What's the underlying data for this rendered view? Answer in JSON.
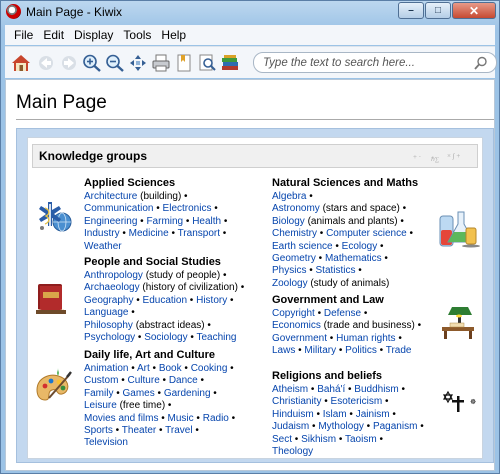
{
  "window": {
    "title": "Main Page - Kiwix",
    "min_label": "–",
    "max_label": "□",
    "close_label": "✕"
  },
  "menu": {
    "file": "File",
    "edit": "Edit",
    "display": "Display",
    "tools": "Tools",
    "help": "Help"
  },
  "toolbar": {
    "icons": [
      "home-icon",
      "back-icon",
      "forward-icon",
      "zoom-in-icon",
      "zoom-out-icon",
      "fullscreen-icon",
      "print-icon",
      "bookmark-icon",
      "find-icon",
      "library-icon"
    ],
    "search_placeholder": "Type the text to search here..."
  },
  "page": {
    "title": "Main Page"
  },
  "kg": {
    "title": "Knowledge groups",
    "sections": {
      "applied": {
        "title": "Applied Sciences",
        "lines": [
          [
            [
              "Architecture",
              1
            ],
            [
              " (building) •",
              0
            ]
          ],
          [
            [
              "Communication",
              1
            ],
            [
              " • ",
              0
            ],
            [
              "Electronics",
              1
            ],
            [
              " •",
              0
            ]
          ],
          [
            [
              "Engineering",
              1
            ],
            [
              " • ",
              0
            ],
            [
              "Farming",
              1
            ],
            [
              " • ",
              0
            ],
            [
              "Health",
              1
            ],
            [
              " •",
              0
            ]
          ],
          [
            [
              "Industry",
              1
            ],
            [
              " • ",
              0
            ],
            [
              "Medicine",
              1
            ],
            [
              " • ",
              0
            ],
            [
              "Transport",
              1
            ],
            [
              " •",
              0
            ]
          ],
          [
            [
              "Weather",
              1
            ]
          ]
        ]
      },
      "people": {
        "title": "People and Social Studies",
        "lines": [
          [
            [
              "Anthropology",
              1
            ],
            [
              " (study of people) •",
              0
            ]
          ],
          [
            [
              "Archaeology",
              1
            ],
            [
              " (history of civilization) •",
              0
            ]
          ],
          [
            [
              "Geography",
              1
            ],
            [
              " • ",
              0
            ],
            [
              "Education",
              1
            ],
            [
              " • ",
              0
            ],
            [
              "History",
              1
            ],
            [
              " •",
              0
            ]
          ],
          [
            [
              "Language",
              1
            ],
            [
              " •",
              0
            ]
          ],
          [
            [
              "Philosophy",
              1
            ],
            [
              " (abstract ideas) •",
              0
            ]
          ],
          [
            [
              "Psychology",
              1
            ],
            [
              " • ",
              0
            ],
            [
              "Sociology",
              1
            ],
            [
              " • ",
              0
            ],
            [
              "Teaching",
              1
            ]
          ]
        ]
      },
      "daily": {
        "title": "Daily life, Art and Culture",
        "lines": [
          [
            [
              "Animation",
              1
            ],
            [
              " • ",
              0
            ],
            [
              "Art",
              1
            ],
            [
              " • ",
              0
            ],
            [
              "Book",
              1
            ],
            [
              " • ",
              0
            ],
            [
              "Cooking",
              1
            ],
            [
              " •",
              0
            ]
          ],
          [
            [
              "Custom",
              1
            ],
            [
              " • ",
              0
            ],
            [
              "Culture",
              1
            ],
            [
              " • ",
              0
            ],
            [
              "Dance",
              1
            ],
            [
              " •",
              0
            ]
          ],
          [
            [
              "Family",
              1
            ],
            [
              " • ",
              0
            ],
            [
              "Games",
              1
            ],
            [
              " • ",
              0
            ],
            [
              "Gardening",
              1
            ],
            [
              " •",
              0
            ]
          ],
          [
            [
              "Leisure",
              1
            ],
            [
              " (free time) •",
              0
            ]
          ],
          [
            [
              "Movies and films",
              1
            ],
            [
              " • ",
              0
            ],
            [
              "Music",
              1
            ],
            [
              " • ",
              0
            ],
            [
              "Radio",
              1
            ],
            [
              " •",
              0
            ]
          ],
          [
            [
              "Sports",
              1
            ],
            [
              " • ",
              0
            ],
            [
              "Theater",
              1
            ],
            [
              " • ",
              0
            ],
            [
              "Travel",
              1
            ],
            [
              " •",
              0
            ]
          ],
          [
            [
              "Television",
              1
            ]
          ]
        ]
      },
      "natural": {
        "title": "Natural Sciences and Maths",
        "lines": [
          [
            [
              "Algebra",
              1
            ],
            [
              " •",
              0
            ]
          ],
          [
            [
              "Astronomy",
              1
            ],
            [
              " (stars and space) •",
              0
            ]
          ],
          [
            [
              "Biology",
              1
            ],
            [
              " (animals and plants) •",
              0
            ]
          ],
          [
            [
              "Chemistry",
              1
            ],
            [
              " • ",
              0
            ],
            [
              "Computer science",
              1
            ],
            [
              " •",
              0
            ]
          ],
          [
            [
              "Earth science",
              1
            ],
            [
              " • ",
              0
            ],
            [
              "Ecology",
              1
            ],
            [
              " •",
              0
            ]
          ],
          [
            [
              "Geometry",
              1
            ],
            [
              " • ",
              0
            ],
            [
              "Mathematics",
              1
            ],
            [
              " •",
              0
            ]
          ],
          [
            [
              "Physics",
              1
            ],
            [
              " • ",
              0
            ],
            [
              "Statistics",
              1
            ],
            [
              " •",
              0
            ]
          ],
          [
            [
              "Zoology",
              1
            ],
            [
              " (study of animals)",
              0
            ]
          ]
        ]
      },
      "gov": {
        "title": "Government and Law",
        "lines": [
          [
            [
              "Copyright",
              1
            ],
            [
              " • ",
              0
            ],
            [
              "Defense",
              1
            ],
            [
              " •",
              0
            ]
          ],
          [
            [
              "Economics",
              1
            ],
            [
              " (trade and business) •",
              0
            ]
          ],
          [
            [
              "Government",
              1
            ],
            [
              " • ",
              0
            ],
            [
              "Human rights",
              1
            ],
            [
              " •",
              0
            ]
          ],
          [
            [
              "Laws",
              1
            ],
            [
              " • ",
              0
            ],
            [
              "Military",
              1
            ],
            [
              " • ",
              0
            ],
            [
              "Politics",
              1
            ],
            [
              " • ",
              0
            ],
            [
              "Trade",
              1
            ]
          ]
        ]
      },
      "religion": {
        "title": "Religions and beliefs",
        "lines": [
          [
            [
              "Atheism",
              1
            ],
            [
              " • ",
              0
            ],
            [
              "Bahá'í",
              1
            ],
            [
              " • ",
              0
            ],
            [
              "Buddhism",
              1
            ],
            [
              " •",
              0
            ]
          ],
          [
            [
              "Christianity",
              1
            ],
            [
              " • ",
              0
            ],
            [
              "Esotericism",
              1
            ],
            [
              " •",
              0
            ]
          ],
          [
            [
              "Hinduism",
              1
            ],
            [
              " • ",
              0
            ],
            [
              "Islam",
              1
            ],
            [
              " • ",
              0
            ],
            [
              "Jainism",
              1
            ],
            [
              " •",
              0
            ]
          ],
          [
            [
              "Judaism",
              1
            ],
            [
              " • ",
              0
            ],
            [
              "Mythology",
              1
            ],
            [
              " • ",
              0
            ],
            [
              "Paganism",
              1
            ],
            [
              " •",
              0
            ]
          ],
          [
            [
              "Sect",
              1
            ],
            [
              " • ",
              0
            ],
            [
              "Sikhism",
              1
            ],
            [
              " • ",
              0
            ],
            [
              "Taoism",
              1
            ],
            [
              " •",
              0
            ]
          ],
          [
            [
              "Theology",
              1
            ]
          ]
        ]
      }
    }
  },
  "colors": {
    "link": "#0645ad",
    "portal_bg": "#c3d8ef",
    "header_bg": "#f0f0f0"
  }
}
